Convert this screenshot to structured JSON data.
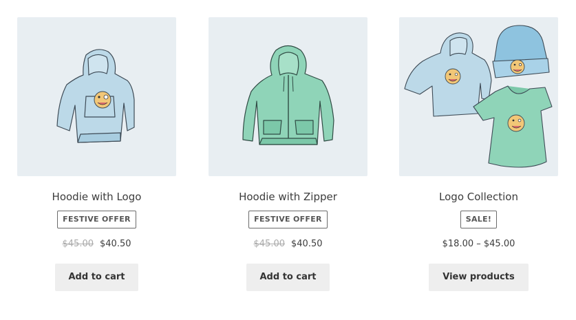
{
  "products": [
    {
      "name": "Hoodie with Logo",
      "badge": "FESTIVE OFFER",
      "price_old": "$45.00",
      "price_new": "$40.50",
      "button": "Add to cart",
      "image": "hoodie-with-logo-image"
    },
    {
      "name": "Hoodie with Zipper",
      "badge": "FESTIVE OFFER",
      "price_old": "$45.00",
      "price_new": "$40.50",
      "button": "Add to cart",
      "image": "hoodie-with-zipper-image"
    },
    {
      "name": "Logo Collection",
      "badge": "SALE!",
      "price_range": "$18.00 – $45.00",
      "button": "View products",
      "image": "logo-collection-image"
    }
  ],
  "colors": {
    "thumb_bg": "#e8eef2",
    "hoodie_blue": "#bcd9e8",
    "hoodie_green": "#8fd4b8",
    "beanie_blue": "#8ec3df",
    "emoji": "#f2c777",
    "button_bg": "#eeeeee"
  }
}
